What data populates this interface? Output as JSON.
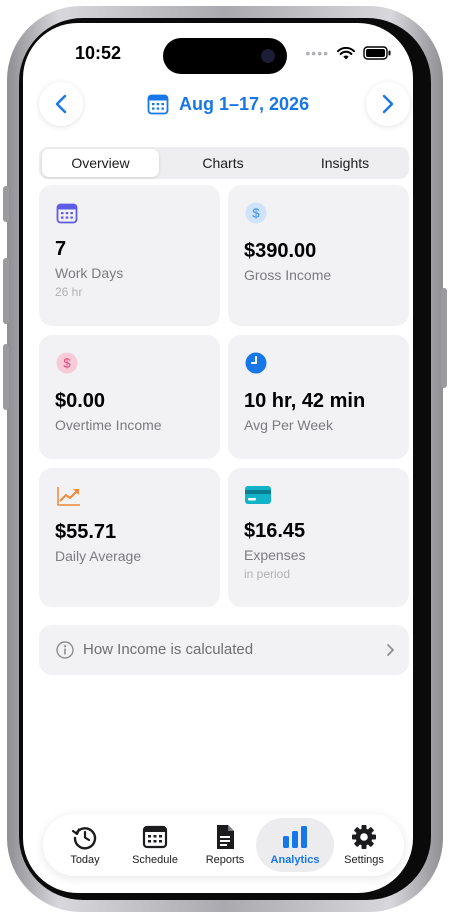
{
  "status_bar": {
    "time": "10:52",
    "dots": "••••"
  },
  "header": {
    "date_range": "Aug 1–17, 2026",
    "prev_icon": "chevron-left-icon",
    "next_icon": "chevron-right-icon",
    "calendar_icon": "calendar-icon",
    "accent_color": "#1877e8"
  },
  "segments": [
    {
      "label": "Overview",
      "active": true
    },
    {
      "label": "Charts",
      "active": false
    },
    {
      "label": "Insights",
      "active": false
    }
  ],
  "cards": {
    "work_days": {
      "value": "7",
      "label": "Work Days",
      "sub": "26 hr",
      "icon": "calendar-icon",
      "color": "#5e5ce6"
    },
    "gross_income": {
      "value": "$390.00",
      "label": "Gross Income",
      "icon": "dollar-circle-icon",
      "color": "#3b8ef0"
    },
    "overtime_income": {
      "value": "$0.00",
      "label": "Overtime Income",
      "icon": "dollar-circle-icon",
      "color": "#e0487a"
    },
    "avg_per_week": {
      "value": "10 hr, 42 min",
      "label": "Avg Per Week",
      "icon": "clock-icon",
      "color": "#1877e8"
    },
    "daily_average": {
      "value": "$55.71",
      "label": "Daily Average",
      "icon": "trend-up-icon",
      "color": "#f0883a"
    },
    "expenses": {
      "value": "$16.45",
      "label": "Expenses",
      "sub": "in period",
      "icon": "credit-card-icon",
      "color": "#12b3c8"
    }
  },
  "info_row": {
    "label": "How Income is calculated",
    "icon": "info-icon",
    "chevron": "chevron-right-icon"
  },
  "tabbar": [
    {
      "label": "Today",
      "icon": "clock-history-icon",
      "active": false
    },
    {
      "label": "Schedule",
      "icon": "calendar-grid-icon",
      "active": false
    },
    {
      "label": "Reports",
      "icon": "document-icon",
      "active": false
    },
    {
      "label": "Analytics",
      "icon": "bar-chart-icon",
      "active": true
    },
    {
      "label": "Settings",
      "icon": "gear-icon",
      "active": false
    }
  ]
}
